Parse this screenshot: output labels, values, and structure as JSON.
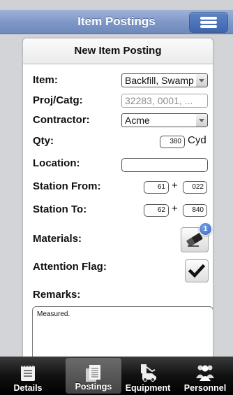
{
  "navbar": {
    "title": "Item Postings"
  },
  "form": {
    "header": "New Item Posting",
    "item": {
      "label": "Item:",
      "value": "Backfill, Swamp"
    },
    "proj_catg": {
      "label": "Proj/Catg:",
      "value": "32283, 0001, ..."
    },
    "contractor": {
      "label": "Contractor:",
      "value": "Acme"
    },
    "qty": {
      "label": "Qty:",
      "value": "380",
      "unit": "Cyd"
    },
    "location": {
      "label": "Location:",
      "value": ""
    },
    "station_from": {
      "label": "Station From:",
      "value1": "61",
      "separator": "+",
      "value2": "022"
    },
    "station_to": {
      "label": "Station To:",
      "value1": "62",
      "separator": "+",
      "value2": "840"
    },
    "materials": {
      "label": "Materials:",
      "badge": "1"
    },
    "attention_flag": {
      "label": "Attention Flag:",
      "checked": true
    },
    "remarks": {
      "label": "Remarks:",
      "value": "Measured."
    }
  },
  "tabbar": {
    "tabs": [
      {
        "label": "Details",
        "icon": "notebook-icon",
        "active": false
      },
      {
        "label": "Postings",
        "icon": "documents-icon",
        "active": true
      },
      {
        "label": "Equipment",
        "icon": "equipment-icon",
        "active": false
      },
      {
        "label": "Personnel",
        "icon": "personnel-icon",
        "active": false
      }
    ]
  },
  "colors": {
    "navbar": "#7d96c6",
    "menu_button": "#4a72b8",
    "badge": "#2d62c2",
    "tabbar": "#111111"
  }
}
